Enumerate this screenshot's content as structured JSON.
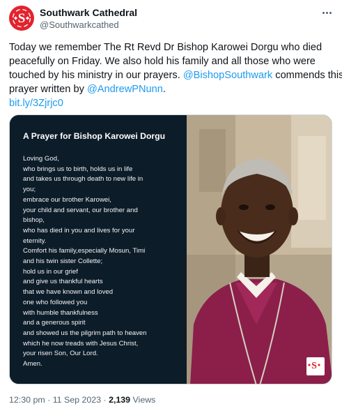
{
  "account": {
    "display_name": "Southwark Cathedral",
    "handle": "@Southwarkcathed",
    "avatar_icon": "diamond-s-logo-icon",
    "brand_color": "#e2232e"
  },
  "more_icon": "more-horizontal-icon",
  "tweet": {
    "line1": "Today we remember The Rt Revd Dr Bishop Karowei Dorgu who died",
    "line2": "peacefully on Friday. We also hold his family and all those who were",
    "line3_pre": "touched by his ministry in our prayers. ",
    "mention1": "@BishopSouthwark",
    "line3_post": " commends this",
    "line4_pre": "prayer written by ",
    "mention2": "@AndrewPNunn",
    "line4_post": ".",
    "short_link": "bit.ly/3Zjrjc0",
    "link_color": "#1d9bf0"
  },
  "media": {
    "prayer_title": "A Prayer for Bishop Karowei Dorgu",
    "prayer_lines": [
      "Loving God,",
      "who brings us to birth, holds us in life",
      "and takes us through death to new life in",
      "you;",
      "embrace our brother Karowei,",
      "your child and servant, our brother and",
      "bishop,",
      "who has died in you and lives for your",
      "eternity.",
      "Comfort his family,especially Mosun, Timi",
      "and his twin sister Collette;",
      "hold us in our grief",
      "and give us thankful hearts",
      "that we have known and loved",
      "one who followed you",
      "with humble thankfulness",
      "and a generous spirit",
      "and showed us the pilgrim path to heaven",
      "which he now treads with Jesus Christ,",
      "your risen Son, Our Lord.",
      "Amen."
    ],
    "panel_color": "#0d1c29",
    "photo_icon": "bishop-portrait-photo",
    "badge_icon": "diamond-s-logo-icon"
  },
  "meta": {
    "time": "12:30 pm",
    "separator": " · ",
    "date": "11 Sep 2023",
    "views_count": "2,139",
    "views_label": " Views"
  }
}
